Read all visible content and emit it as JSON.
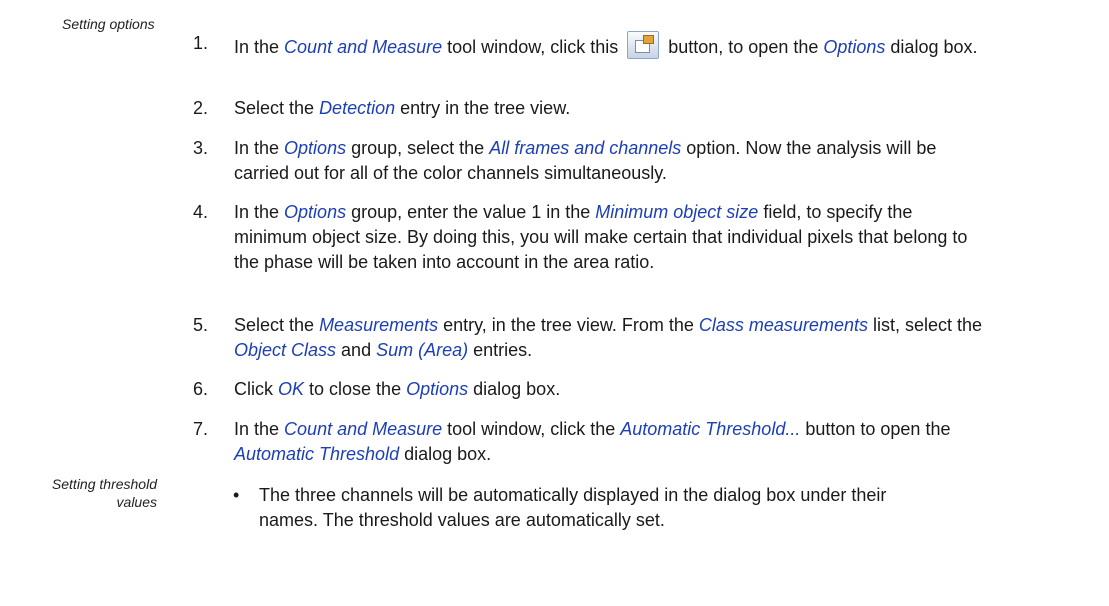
{
  "sidebar": {
    "setting_options": "Setting options",
    "setting_threshold_1": "Setting threshold",
    "setting_threshold_2": "values"
  },
  "steps": [
    {
      "num": "1.",
      "parts": [
        "In the ",
        "Count and Measure",
        " tool window, click this ",
        " button, to open the ",
        "Options",
        " dialog box."
      ]
    },
    {
      "num": "2.",
      "parts": [
        "Select the ",
        "Detection",
        " entry in the tree view."
      ]
    },
    {
      "num": "3.",
      "parts": [
        "In the ",
        "Options",
        " group, select the ",
        "All frames and channels",
        " option. Now the analysis will be carried out for all of the color channels simultaneously."
      ]
    },
    {
      "num": "4.",
      "parts": [
        "In the ",
        "Options",
        " group, enter the value 1 in the ",
        "Minimum object size",
        " field, to specify the minimum object size. By doing this, you will make certain that individual pixels that belong to the phase will be taken into account in the area ratio."
      ]
    },
    {
      "num": "5.",
      "parts": [
        "Select the ",
        "Measurements",
        " entry, in the tree view. From the ",
        "Class measurements",
        " list, select the ",
        "Object Class",
        " and ",
        "Sum (Area)",
        " entries."
      ]
    },
    {
      "num": "6.",
      "parts": [
        "Click ",
        "OK",
        " to close the ",
        "Options",
        " dialog box."
      ]
    },
    {
      "num": "7.",
      "parts": [
        "In the ",
        "Count and Measure",
        " tool window, click the ",
        "Automatic Threshold...",
        " button to open the ",
        "Automatic Threshold",
        " dialog box."
      ]
    }
  ],
  "bullet": {
    "dot": "•",
    "text": "The three channels will be automatically displayed in the dialog box under their names. The threshold values are automatically set."
  },
  "icons": {
    "options_button": "options-icon"
  },
  "colors": {
    "keyword": "#1c3fb5"
  }
}
